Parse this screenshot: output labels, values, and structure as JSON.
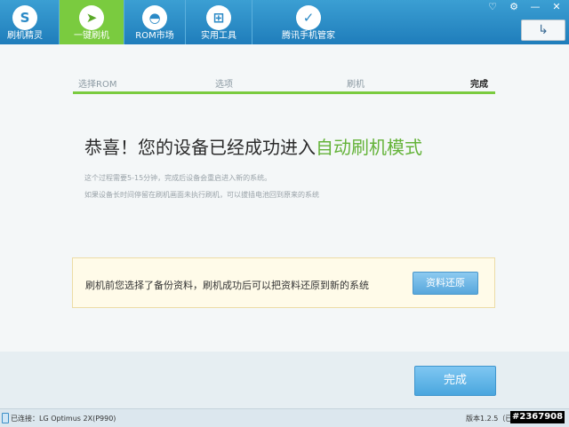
{
  "nav": {
    "tabs": [
      {
        "label": "刷机精灵",
        "icon": "shuaji-logo-icon"
      },
      {
        "label": "一键刷机",
        "icon": "cursor-arrow-icon",
        "active": true
      },
      {
        "label": "ROM市场",
        "icon": "android-icon"
      },
      {
        "label": "实用工具",
        "icon": "tools-grid-icon"
      },
      {
        "label": "腾讯手机管家",
        "icon": "shield-icon"
      }
    ],
    "accent_active": "#7acb3f"
  },
  "window": {
    "buttons": [
      {
        "name": "feedback-icon",
        "glyph": "♡"
      },
      {
        "name": "settings-icon",
        "glyph": "⚙"
      },
      {
        "name": "minimize-icon",
        "glyph": "—"
      },
      {
        "name": "close-icon",
        "glyph": "✕"
      }
    ],
    "back_glyph": "↳"
  },
  "steps": [
    "选择ROM",
    "选项",
    "刷机",
    "完成"
  ],
  "headline": {
    "prefix": "恭喜！您的设备已经成功进入",
    "highlight": "自动刷机模式"
  },
  "desc": [
    "这个过程需要5-15分钟，完成后设备会重启进入新的系统。",
    "如果设备长时间停留在刷机画面未执行刷机，可以拔插电池回到原来的系统"
  ],
  "notice": {
    "text": "刷机前您选择了备份资料，刷机成功后可以把资料还原到新的系统",
    "button": "资料还原"
  },
  "done_button": "完成",
  "status": {
    "connection": "已连接：LG Optimus 2X(P990)",
    "version": "版本1.2.5（已"
  },
  "watermark": "#2367908"
}
